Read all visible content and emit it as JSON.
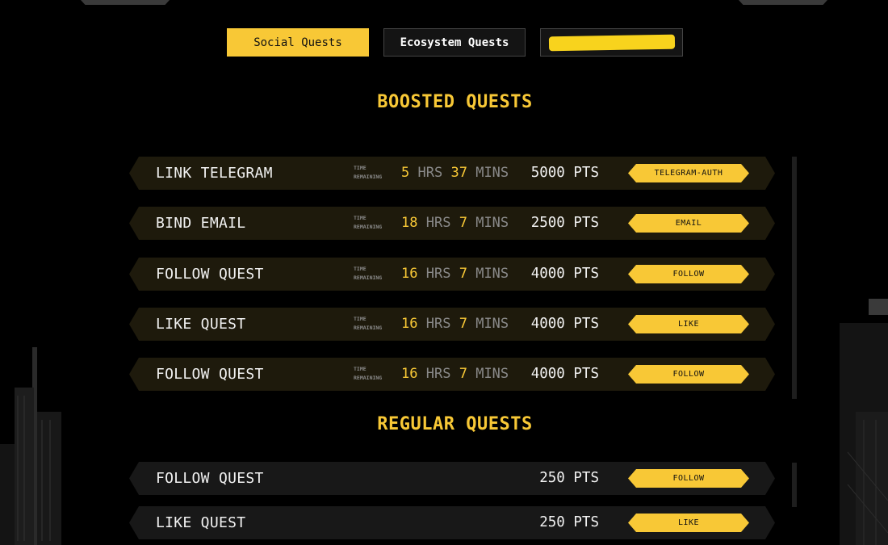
{
  "tabs": {
    "social": "Social Quests",
    "ecosystem": "Ecosystem Quests"
  },
  "sections": {
    "boosted_title": "BOOSTED QUESTS",
    "regular_title": "REGULAR QUESTS"
  },
  "time_label": [
    "TIME",
    "REMAINING"
  ],
  "time_units": {
    "hours": "HRS",
    "minutes": "MINS"
  },
  "boosted": [
    {
      "name": "LINK TELEGRAM",
      "hours": "5",
      "minutes": "37",
      "points": "5000 PTS",
      "action": "TELEGRAM-AUTH"
    },
    {
      "name": "BIND EMAIL",
      "hours": "18",
      "minutes": "7",
      "points": "2500 PTS",
      "action": "EMAIL"
    },
    {
      "name": "FOLLOW QUEST",
      "hours": "16",
      "minutes": "7",
      "points": "4000 PTS",
      "action": "FOLLOW"
    },
    {
      "name": "LIKE QUEST",
      "hours": "16",
      "minutes": "7",
      "points": "4000 PTS",
      "action": "LIKE"
    },
    {
      "name": "FOLLOW QUEST",
      "hours": "16",
      "minutes": "7",
      "points": "4000 PTS",
      "action": "FOLLOW"
    }
  ],
  "regular": [
    {
      "name": "FOLLOW QUEST",
      "points": "250 PTS",
      "action": "FOLLOW"
    },
    {
      "name": "LIKE QUEST",
      "points": "250 PTS",
      "action": "LIKE"
    }
  ],
  "colors": {
    "accent": "#f8c836",
    "background": "#000000",
    "row_boosted": "#1e1a0c",
    "row_regular": "#181818"
  }
}
